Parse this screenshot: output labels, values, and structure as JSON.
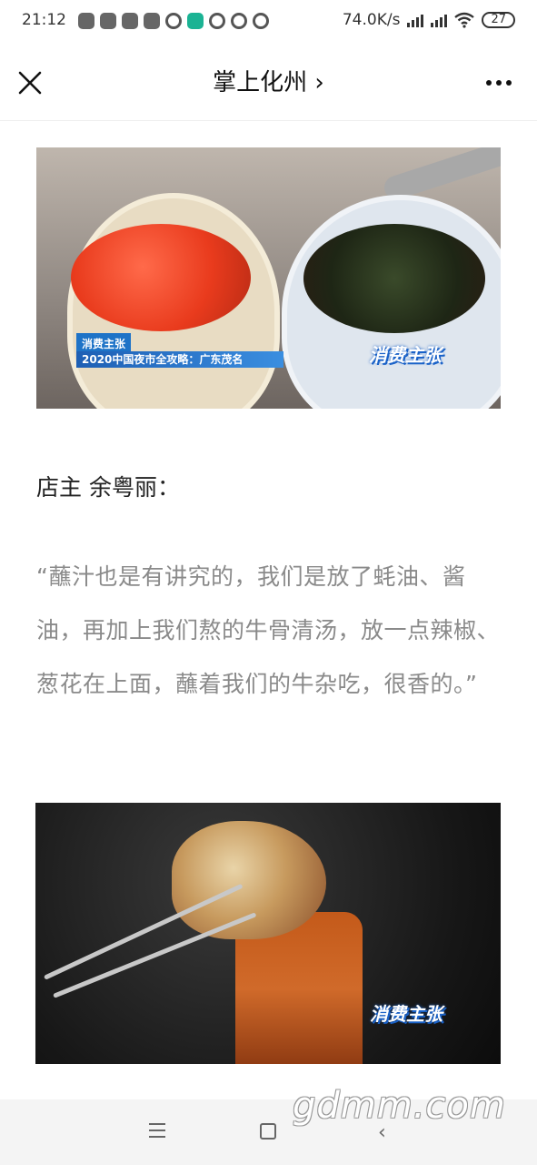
{
  "status_bar": {
    "time": "21:12",
    "network_speed": "74.0K/s",
    "battery": "27",
    "notification_icons": [
      "wechat-icon",
      "wechat-icon",
      "wechat-icon",
      "mi-icon",
      "qq-icon",
      "app-icon",
      "qq-icon",
      "qq-icon",
      "qq-icon"
    ]
  },
  "header": {
    "title": "掌上化州 ›",
    "close_icon": "close-icon",
    "more_icon": "more-icon"
  },
  "article": {
    "image1": {
      "tag": "消费主张",
      "caption": "2020中国夜市全攻略：广东茂名",
      "watermark": "消费主张"
    },
    "speaker": "店主 余粤丽：",
    "quote": "“蘸汁也是有讲究的，我们是放了蚝油、酱油，再加上我们熬的牛骨清汤，放一点辣椒、葱花在上面，蘸着我们的牛杂吃，很香的。”",
    "image2": {
      "watermark": "消费主张"
    }
  },
  "nav_bar": {
    "site_watermark": "gdmm.com"
  },
  "colors": {
    "accent_blue": "#1e73c7",
    "quote_gray": "#8a8a8a"
  }
}
